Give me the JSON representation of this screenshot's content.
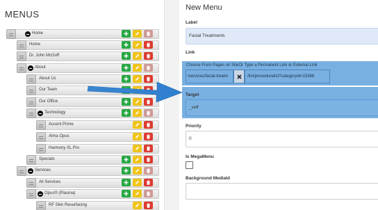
{
  "left_panel": {
    "title": "MENUS",
    "tree": [
      {
        "label": "Home",
        "collapsible": true
      },
      {
        "label": "Home",
        "collapsible": false
      },
      {
        "label": "Dr. John McGoff",
        "collapsible": false
      },
      {
        "label": "About",
        "collapsible": true
      },
      {
        "label": "About Us",
        "collapsible": false
      },
      {
        "label": "Our Team",
        "collapsible": false
      },
      {
        "label": "Our Office",
        "collapsible": false
      },
      {
        "label": "Technology",
        "collapsible": true
      },
      {
        "label": "Accent Prime",
        "collapsible": false
      },
      {
        "label": "Alma Opus",
        "collapsible": false
      },
      {
        "label": "Harmony XL Pro",
        "collapsible": false
      },
      {
        "label": "Specials",
        "collapsible": false
      },
      {
        "label": "Services",
        "collapsible": true
      },
      {
        "label": "All Services",
        "collapsible": false
      },
      {
        "label": "Opus® (Plasma)",
        "collapsible": true
      },
      {
        "label": "RF Skin Resurfacing",
        "collapsible": false
      }
    ],
    "icons": {
      "add": "plus-icon",
      "edit": "pencil-icon",
      "delete": "trash-icon",
      "collapse": "minus-circle-icon"
    },
    "colors": {
      "add": "#27a844",
      "edit": "#f0c419",
      "delete": "#dd3b30"
    }
  },
  "form": {
    "title": "New Menu",
    "label_field": {
      "label": "Label",
      "value": "Facial Treatments"
    },
    "link_field": {
      "label": "Link",
      "help": "Choose From Pages on SiteOr Type a Permanent Link or External Link",
      "page_value": "/services/facial-treatm",
      "url_value": "/list/procedurelist?categoryid=15388",
      "clear_icon": "x-icon"
    },
    "target_field": {
      "label": "Target",
      "value": "_self"
    },
    "priority_field": {
      "label": "Priority",
      "value": "0"
    },
    "megamenu_field": {
      "label": "Is MegaMenu",
      "checked": false
    },
    "media_field": {
      "label": "Background MediaId",
      "value": ""
    },
    "highlight_color": "#79b0e1"
  },
  "annotation": {
    "icon": "arrow-right-icon",
    "color": "#3b8fd6"
  }
}
